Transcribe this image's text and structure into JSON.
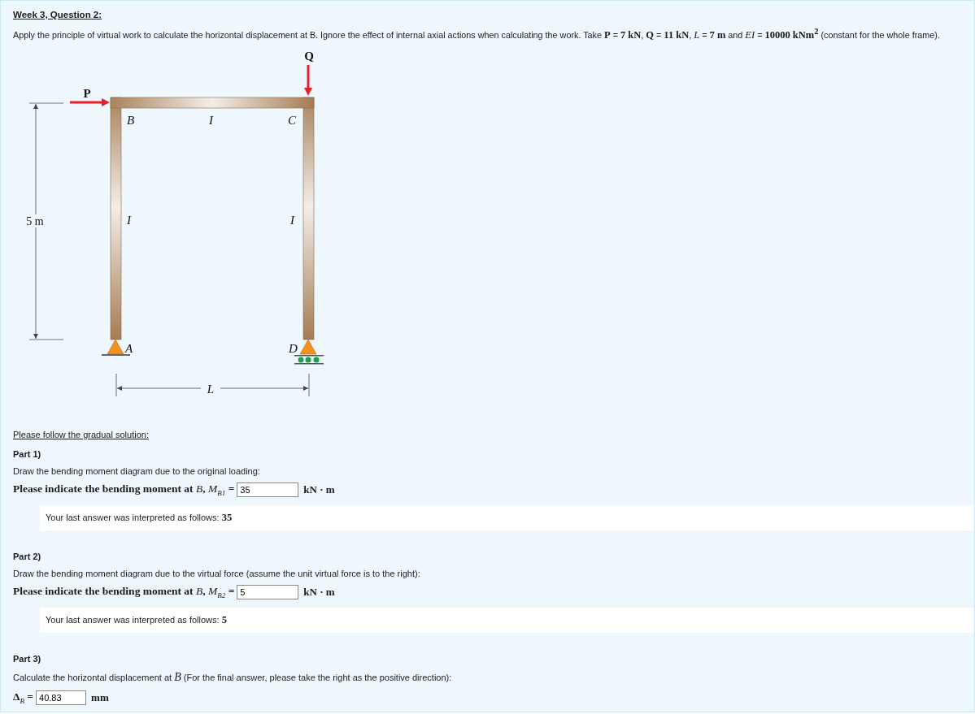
{
  "title": "Week 3, Question 2:",
  "statement": "Apply the principle of virtual work to calculate the horizontal displacement at B. Ignore the effect of internal axial actions when calculating the work. Take **P** = **7 kN**, **Q** = **11 kN**, *L* = **7 m** and *EI* = **10000 kNm$^{2}$** (constant for the whole frame).",
  "figure": {
    "loads": [
      "P",
      "Q"
    ],
    "joints": [
      "B",
      "C",
      "A",
      "D"
    ],
    "members": [
      "I",
      "I",
      "I"
    ],
    "height": "5 m",
    "span": "L"
  },
  "intro": "Please follow the gradual solution:",
  "parts": [
    {
      "heading": "Part 1)",
      "instruction": "Draw the bending moment diagram due to the original loading:",
      "prompt": "Please indicate the bending moment at *B*, *M*$_{B1}$ =",
      "value": "35",
      "unit": "kN · m",
      "feedback": "Your last answer was interpreted as follows: **35**"
    },
    {
      "heading": "Part 2)",
      "instruction": "Draw the bending moment diagram due to the virtual force (assume the unit virtual force is to the right):",
      "prompt": "Please indicate the bending moment at *B*, *M*$_{B2}$ =",
      "value": "5",
      "unit": "kN · m",
      "feedback": "Your last answer was interpreted as follows: **5**"
    },
    {
      "heading": "Part 3)",
      "instruction": "Calculate the horizontal displacement at *B* (For the final answer, please take the right as the positive direction):",
      "prompt": "**Δ**$_{B}$ =",
      "value": "40.83",
      "unit": "mm"
    }
  ]
}
